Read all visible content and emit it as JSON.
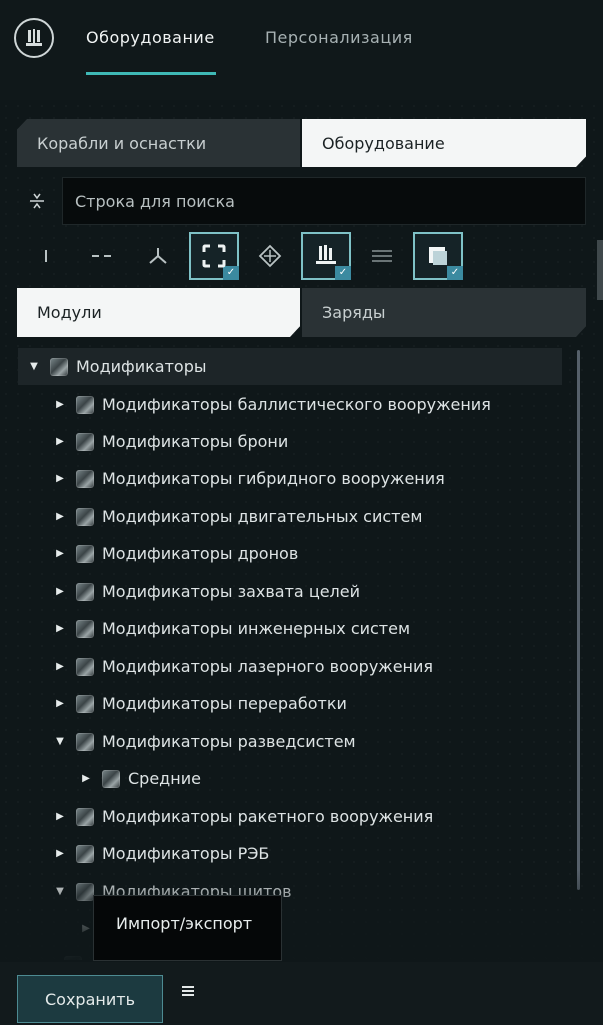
{
  "header": {
    "tabs": [
      {
        "label": "Оборудование",
        "active": true
      },
      {
        "label": "Персонализация",
        "active": false
      }
    ],
    "accent_color": "#3fb9b6"
  },
  "category_tabs": [
    {
      "label": "Корабли и оснастки",
      "active": false
    },
    {
      "label": "Оборудование",
      "active": true
    }
  ],
  "search": {
    "placeholder": "Строка для поиска",
    "value": ""
  },
  "filters": [
    {
      "icon": "high-slot-icon",
      "active": false
    },
    {
      "icon": "mid-slot-icon",
      "active": false
    },
    {
      "icon": "low-slot-icon",
      "active": false
    },
    {
      "icon": "rig-slot-icon",
      "active": true
    },
    {
      "icon": "drone-icon",
      "active": false
    },
    {
      "icon": "skill-filter-icon",
      "active": true
    },
    {
      "icon": "list-view-icon",
      "active": false
    },
    {
      "icon": "resources-icon",
      "active": true
    }
  ],
  "subtabs": [
    {
      "label": "Модули",
      "active": true
    },
    {
      "label": "Заряды",
      "active": false
    }
  ],
  "tree": [
    {
      "label": "Модификаторы",
      "expanded": true,
      "level": 0
    },
    {
      "label": "Модификаторы баллистического вооружения",
      "expanded": false,
      "level": 1
    },
    {
      "label": "Модификаторы брони",
      "expanded": false,
      "level": 1
    },
    {
      "label": "Модификаторы гибридного вооружения",
      "expanded": false,
      "level": 1
    },
    {
      "label": "Модификаторы двигательных систем",
      "expanded": false,
      "level": 1
    },
    {
      "label": "Модификаторы дронов",
      "expanded": false,
      "level": 1
    },
    {
      "label": "Модификаторы захвата целей",
      "expanded": false,
      "level": 1
    },
    {
      "label": "Модификаторы инженерных систем",
      "expanded": false,
      "level": 1
    },
    {
      "label": "Модификаторы лазерного вооружения",
      "expanded": false,
      "level": 1
    },
    {
      "label": "Модификаторы переработки",
      "expanded": false,
      "level": 1
    },
    {
      "label": "Модификаторы разведсистем",
      "expanded": true,
      "level": 1
    },
    {
      "label": "Средние",
      "expanded": false,
      "level": 2
    },
    {
      "label": "Модификаторы ракетного вооружения",
      "expanded": false,
      "level": 1
    },
    {
      "label": "Модификаторы РЭБ",
      "expanded": false,
      "level": 1
    },
    {
      "label": "Модификаторы щитов",
      "expanded": true,
      "level": 1
    }
  ],
  "footer": {
    "save_label": "Сохранить",
    "menu_icon": "hamburger-icon"
  },
  "tooltip": {
    "text": "Импорт/экспорт"
  }
}
